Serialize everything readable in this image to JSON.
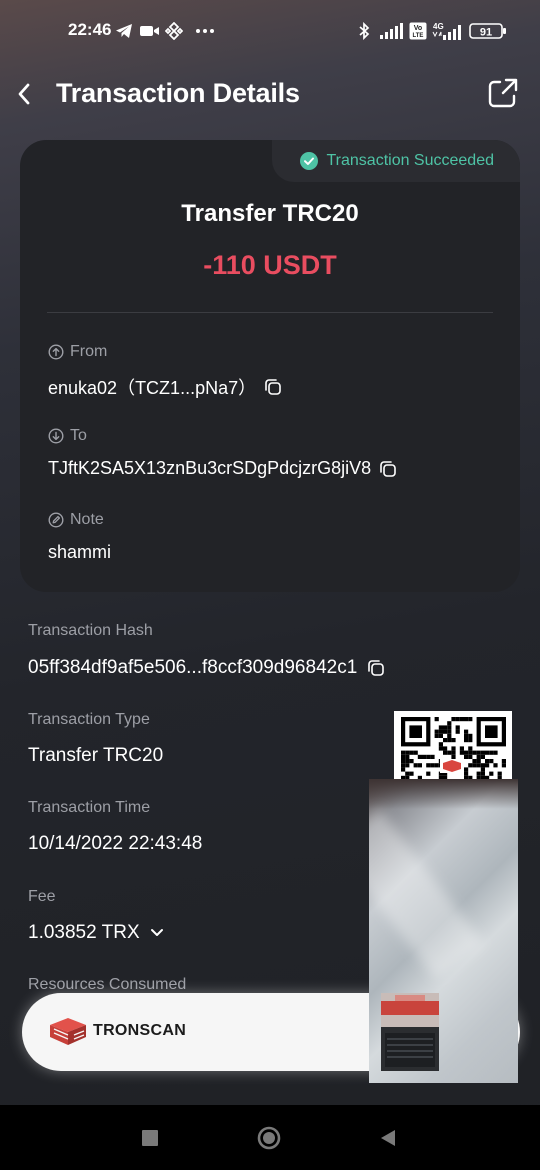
{
  "status_bar": {
    "time": "22:46",
    "left_icons": [
      "telegram-icon",
      "video-camera-icon",
      "binance-icon",
      "more-dots-icon"
    ],
    "right_icons": [
      "bluetooth-icon",
      "signal-icon",
      "volte-icon",
      "4g-signal-icon",
      "battery-icon"
    ],
    "network_label": "4G",
    "volte_label": "Vo LTE",
    "battery": "91"
  },
  "header": {
    "title": "Transaction Details",
    "back_icon": "chevron-left-icon",
    "share_icon": "share-icon"
  },
  "card": {
    "status": "Transaction Succeeded",
    "status_color": "#4ec3a5",
    "title": "Transfer TRC20",
    "amount": "-110 USDT",
    "amount_color": "#e94d60",
    "from_label": "From",
    "from_value": "enuka02（TCZ1...pNa7）",
    "to_label": "To",
    "to_value": "TJftK2SA5X13znBu3crSDgPdcjzrG8jiV8",
    "note_label": "Note",
    "note_value": "shammi"
  },
  "details": {
    "hash_label": "Transaction Hash",
    "hash_value": "05ff384df9af5e506...f8ccf309d96842c1",
    "type_label": "Transaction Type",
    "type_value": "Transfer TRC20",
    "time_label": "Transaction Time",
    "time_value": "10/14/2022 22:43:48",
    "fee_label": "Fee",
    "fee_value": "1.03852 TRX",
    "resources_label": "Resources Consumed"
  },
  "tronscan": {
    "label": "TRONSCAN"
  },
  "nav": {
    "icons": [
      "recent-apps-icon",
      "home-icon",
      "back-triangle-icon"
    ]
  }
}
